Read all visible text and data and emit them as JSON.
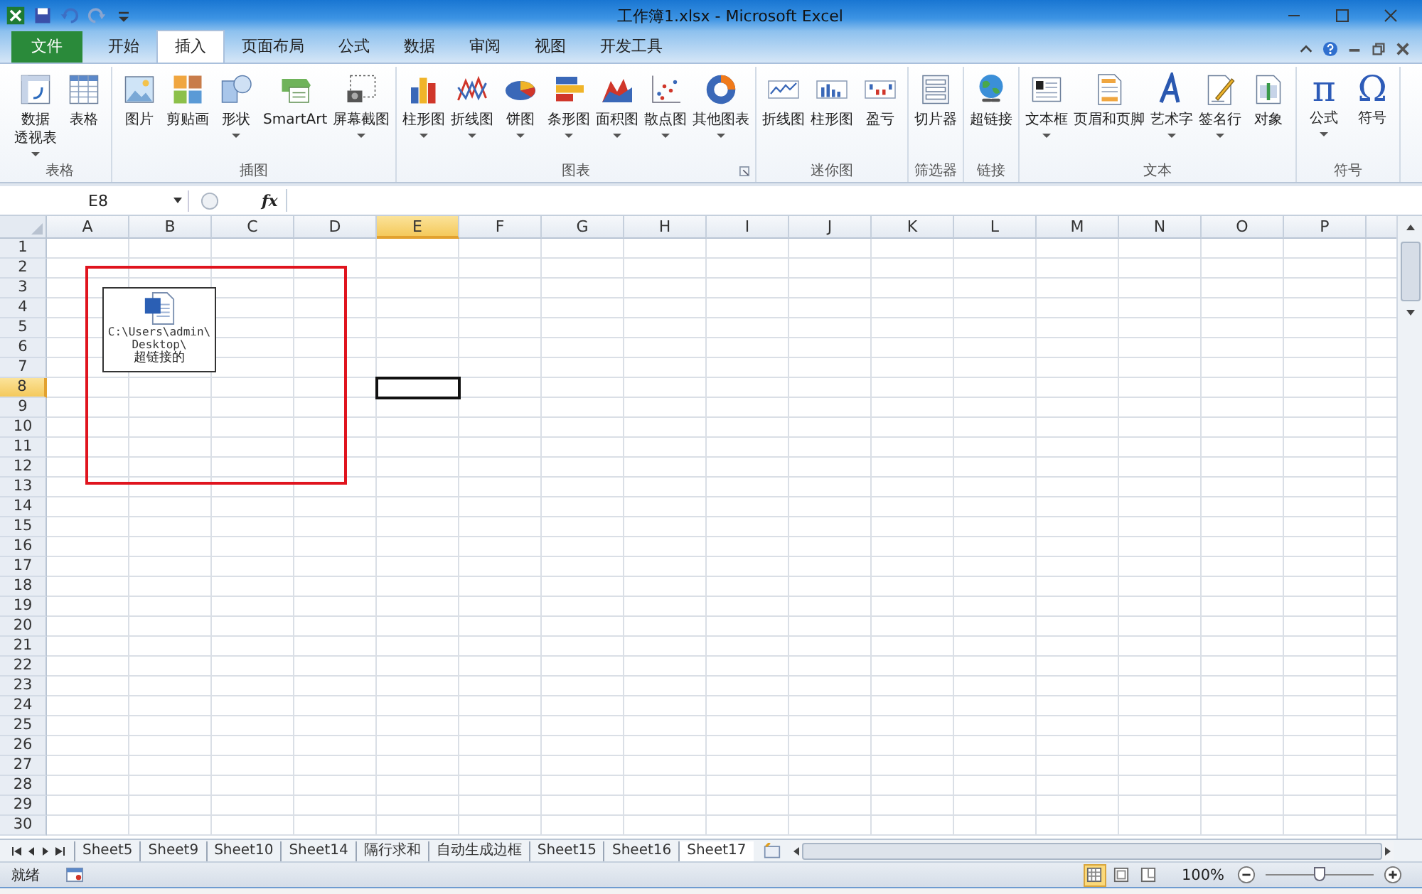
{
  "window": {
    "title": "工作簿1.xlsx - Microsoft Excel"
  },
  "ribbon_tabs": [
    {
      "label": "文件",
      "kind": "file",
      "selected": false
    },
    {
      "label": "开始",
      "kind": "tab",
      "selected": false
    },
    {
      "label": "插入",
      "kind": "tab",
      "selected": true
    },
    {
      "label": "页面布局",
      "kind": "tab",
      "selected": false
    },
    {
      "label": "公式",
      "kind": "tab",
      "selected": false
    },
    {
      "label": "数据",
      "kind": "tab",
      "selected": false
    },
    {
      "label": "审阅",
      "kind": "tab",
      "selected": false
    },
    {
      "label": "视图",
      "kind": "tab",
      "selected": false
    },
    {
      "label": "开发工具",
      "kind": "tab",
      "selected": false
    }
  ],
  "ribbon_groups": [
    {
      "label": "表格",
      "launcher": false,
      "buttons": [
        {
          "label": "数据",
          "label_2": "透视表",
          "dropdown": true
        },
        {
          "label": "表格",
          "dropdown": false
        }
      ]
    },
    {
      "label": "插图",
      "launcher": false,
      "buttons": [
        {
          "label": "图片",
          "dropdown": false
        },
        {
          "label": "剪贴画",
          "dropdown": false
        },
        {
          "label": "形状",
          "dropdown": true
        },
        {
          "label": "SmartArt",
          "dropdown": false
        },
        {
          "label": "屏幕截图",
          "dropdown": true
        }
      ]
    },
    {
      "label": "图表",
      "launcher": true,
      "buttons": [
        {
          "label": "柱形图",
          "dropdown": true
        },
        {
          "label": "折线图",
          "dropdown": true
        },
        {
          "label": "饼图",
          "dropdown": true
        },
        {
          "label": "条形图",
          "dropdown": true
        },
        {
          "label": "面积图",
          "dropdown": true
        },
        {
          "label": "散点图",
          "dropdown": true
        },
        {
          "label": "其他图表",
          "dropdown": true
        }
      ]
    },
    {
      "label": "迷你图",
      "launcher": false,
      "buttons": [
        {
          "label": "折线图",
          "dropdown": false
        },
        {
          "label": "柱形图",
          "dropdown": false
        },
        {
          "label": "盈亏",
          "dropdown": false
        }
      ]
    },
    {
      "label": "筛选器",
      "launcher": false,
      "buttons": [
        {
          "label": "切片器",
          "dropdown": false
        }
      ]
    },
    {
      "label": "链接",
      "launcher": false,
      "buttons": [
        {
          "label": "超链接",
          "dropdown": false
        }
      ]
    },
    {
      "label": "文本",
      "launcher": false,
      "buttons": [
        {
          "label": "文本框",
          "dropdown": true
        },
        {
          "label": "页眉和页脚",
          "dropdown": false
        },
        {
          "label": "艺术字",
          "dropdown": true
        },
        {
          "label": "签名行",
          "dropdown": true
        },
        {
          "label": "对象",
          "dropdown": false
        }
      ]
    },
    {
      "label": "符号",
      "launcher": false,
      "buttons": [
        {
          "label": "公式",
          "glyph": "π",
          "dropdown": true
        },
        {
          "label": "符号",
          "glyph": "Ω",
          "dropdown": false
        }
      ]
    }
  ],
  "formula_bar": {
    "name_box": "E8",
    "fx": "fx"
  },
  "columns": [
    {
      "label": "A",
      "selected": false
    },
    {
      "label": "B",
      "selected": false
    },
    {
      "label": "C",
      "selected": false
    },
    {
      "label": "D",
      "selected": false
    },
    {
      "label": "E",
      "selected": true
    },
    {
      "label": "F",
      "selected": false
    },
    {
      "label": "G",
      "selected": false
    },
    {
      "label": "H",
      "selected": false
    },
    {
      "label": "I",
      "selected": false
    },
    {
      "label": "J",
      "selected": false
    },
    {
      "label": "K",
      "selected": false
    },
    {
      "label": "L",
      "selected": false
    },
    {
      "label": "M",
      "selected": false
    },
    {
      "label": "N",
      "selected": false
    },
    {
      "label": "O",
      "selected": false
    },
    {
      "label": "P",
      "selected": false
    }
  ],
  "rows": [
    {
      "label": "1",
      "selected": false
    },
    {
      "label": "2",
      "selected": false
    },
    {
      "label": "3",
      "selected": false
    },
    {
      "label": "4",
      "selected": false
    },
    {
      "label": "5",
      "selected": false
    },
    {
      "label": "6",
      "selected": false
    },
    {
      "label": "7",
      "selected": false
    },
    {
      "label": "8",
      "selected": true
    },
    {
      "label": "9",
      "selected": false
    },
    {
      "label": "10",
      "selected": false
    },
    {
      "label": "11",
      "selected": false
    },
    {
      "label": "12",
      "selected": false
    },
    {
      "label": "13",
      "selected": false
    },
    {
      "label": "14",
      "selected": false
    },
    {
      "label": "15",
      "selected": false
    },
    {
      "label": "16",
      "selected": false
    },
    {
      "label": "17",
      "selected": false
    },
    {
      "label": "18",
      "selected": false
    },
    {
      "label": "19",
      "selected": false
    },
    {
      "label": "20",
      "selected": false
    },
    {
      "label": "21",
      "selected": false
    },
    {
      "label": "22",
      "selected": false
    },
    {
      "label": "23",
      "selected": false
    },
    {
      "label": "24",
      "selected": false
    },
    {
      "label": "25",
      "selected": false
    },
    {
      "label": "26",
      "selected": false
    },
    {
      "label": "27",
      "selected": false
    },
    {
      "label": "28",
      "selected": false
    },
    {
      "label": "29",
      "selected": false
    },
    {
      "label": "30",
      "selected": false
    }
  ],
  "embedded_object": {
    "path_lines": [
      "C:\\Users\\admin\\",
      "Desktop\\"
    ],
    "caption": "超链接的"
  },
  "sheet_tabs": [
    {
      "label": "Sheet5",
      "selected": false
    },
    {
      "label": "Sheet9",
      "selected": false
    },
    {
      "label": "Sheet10",
      "selected": false
    },
    {
      "label": "Sheet14",
      "selected": false
    },
    {
      "label": "隔行求和",
      "selected": false
    },
    {
      "label": "自动生成边框",
      "selected": false
    },
    {
      "label": "Sheet15",
      "selected": false
    },
    {
      "label": "Sheet16",
      "selected": false
    },
    {
      "label": "Sheet17",
      "selected": true
    }
  ],
  "status_bar": {
    "status": "就绪",
    "view_buttons": [
      {
        "selected": true
      },
      {
        "selected": false
      },
      {
        "selected": false
      }
    ],
    "zoom": {
      "reading": "100%",
      "level": 0.5
    }
  }
}
